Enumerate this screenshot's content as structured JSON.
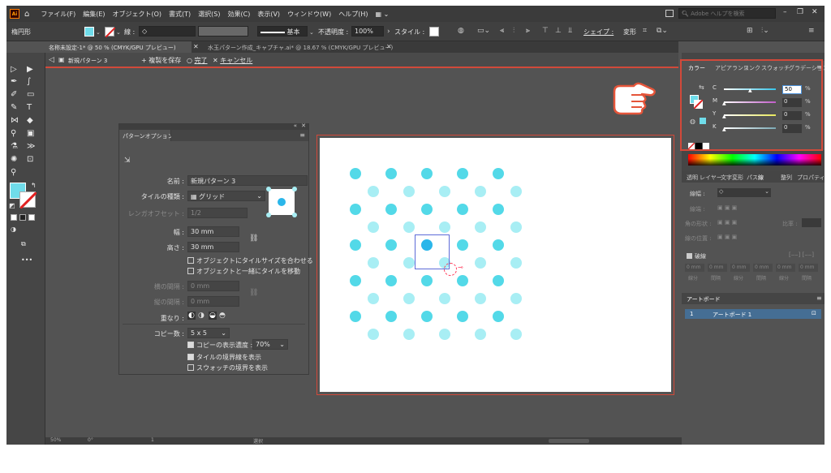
{
  "app": {
    "logo_text": "Ai"
  },
  "menu": [
    "ファイル(F)",
    "編集(E)",
    "オブジェクト(O)",
    "書式(T)",
    "選択(S)",
    "効果(C)",
    "表示(V)",
    "ウィンドウ(W)",
    "ヘルプ(H)"
  ],
  "menubar": {
    "search_placeholder": "Adobe ヘルプを検索",
    "workspace_icon": "grid-dropdown-icon",
    "window_controls": [
      "minimize-icon",
      "restore-icon",
      "close-icon"
    ]
  },
  "controlbar": {
    "object_type": "楕円形",
    "stroke_label": "線 :",
    "stroke_style": "基本",
    "opacity_label": "不透明度 :",
    "opacity_value": "100%",
    "style_label": "スタイル :",
    "shape_label": "シェイプ :",
    "transform_label": "変形",
    "fill_color": "#6fdcea"
  },
  "tabs": [
    {
      "label": "名称未設定-1* @ 50 % (CMYK/GPU プレビュー)",
      "active": true
    },
    {
      "label": "水玉パターン作成_キャプチャ.ai* @ 18.67 % (CMYK/GPU プレビュー)",
      "active": false
    }
  ],
  "isolation": {
    "pattern_name": "新規パターン 3",
    "save_copy": "+ 複製を保存",
    "done": "完了",
    "cancel": "キャンセル"
  },
  "pattern_options": {
    "title": "パターンオプション",
    "name_label": "名前 :",
    "name_value": "新規パターン 3",
    "tile_type_label": "タイルの種類 :",
    "tile_type_value": "グリッド",
    "brick_offset_label": "レンガオフセット :",
    "brick_offset_value": "1/2",
    "width_label": "幅 :",
    "width_value": "30 mm",
    "height_label": "高さ :",
    "height_value": "30 mm",
    "fit_tile": "オブジェクトにタイルサイズを合わせる",
    "move_tile": "オブジェクトと一緒にタイルを移動",
    "h_spacing_label": "横の間隔 :",
    "h_spacing_value": "0 mm",
    "v_spacing_label": "縦の間隔 :",
    "v_spacing_value": "0 mm",
    "overlap_label": "重なり :",
    "copies_label": "コピー数 :",
    "copies_value": "5 x 5",
    "dim_copies_label": "コピーの表示濃度 :",
    "dim_copies_value": "70%",
    "show_tile_edge": "タイルの境界線を表示",
    "show_swatch_bounds": "スウォッチの境界を表示"
  },
  "color_panel": {
    "tabs": [
      "カラー",
      "アピアランス",
      "リンク",
      "スウォッチ",
      "グラデーション"
    ],
    "channels": [
      {
        "name": "C",
        "value": "50",
        "color": "#36c4e8"
      },
      {
        "name": "M",
        "value": "0",
        "color": "#c05cc8"
      },
      {
        "name": "Y",
        "value": "0",
        "color": "#e8e85c"
      },
      {
        "name": "K",
        "value": "0",
        "color": "#7aa8b4"
      }
    ],
    "percent": "%"
  },
  "stroke_panel": {
    "tabs": [
      "透明",
      "レイヤー",
      "文字",
      "変形",
      "パス",
      "線",
      "整列",
      "プロパティ"
    ],
    "weight_label": "線幅 :",
    "cap_label": "線端 :",
    "corner_label": "角の形状 :",
    "limit_label": "比率 :",
    "align_label": "線の位置 :",
    "dashed_label": "破線",
    "dash_fields": [
      "0 mm",
      "0 mm",
      "0 mm",
      "0 mm",
      "0 mm",
      "0 mm"
    ],
    "dash_labels": [
      "線分",
      "間隔",
      "線分",
      "間隔",
      "線分",
      "間隔"
    ]
  },
  "artboards_panel": {
    "title": "アートボード",
    "row_number": "1",
    "row_name": "アートボード 1"
  },
  "statusbar": {
    "zoom": "50%",
    "rotation": "0°",
    "artboard_nav": "1",
    "mode": "選択"
  },
  "colors": {
    "accent_red": "#d2493a",
    "dot_dark": "#53d9e8",
    "dot_light": "#a8eef4",
    "ui_bg": "#535353"
  }
}
